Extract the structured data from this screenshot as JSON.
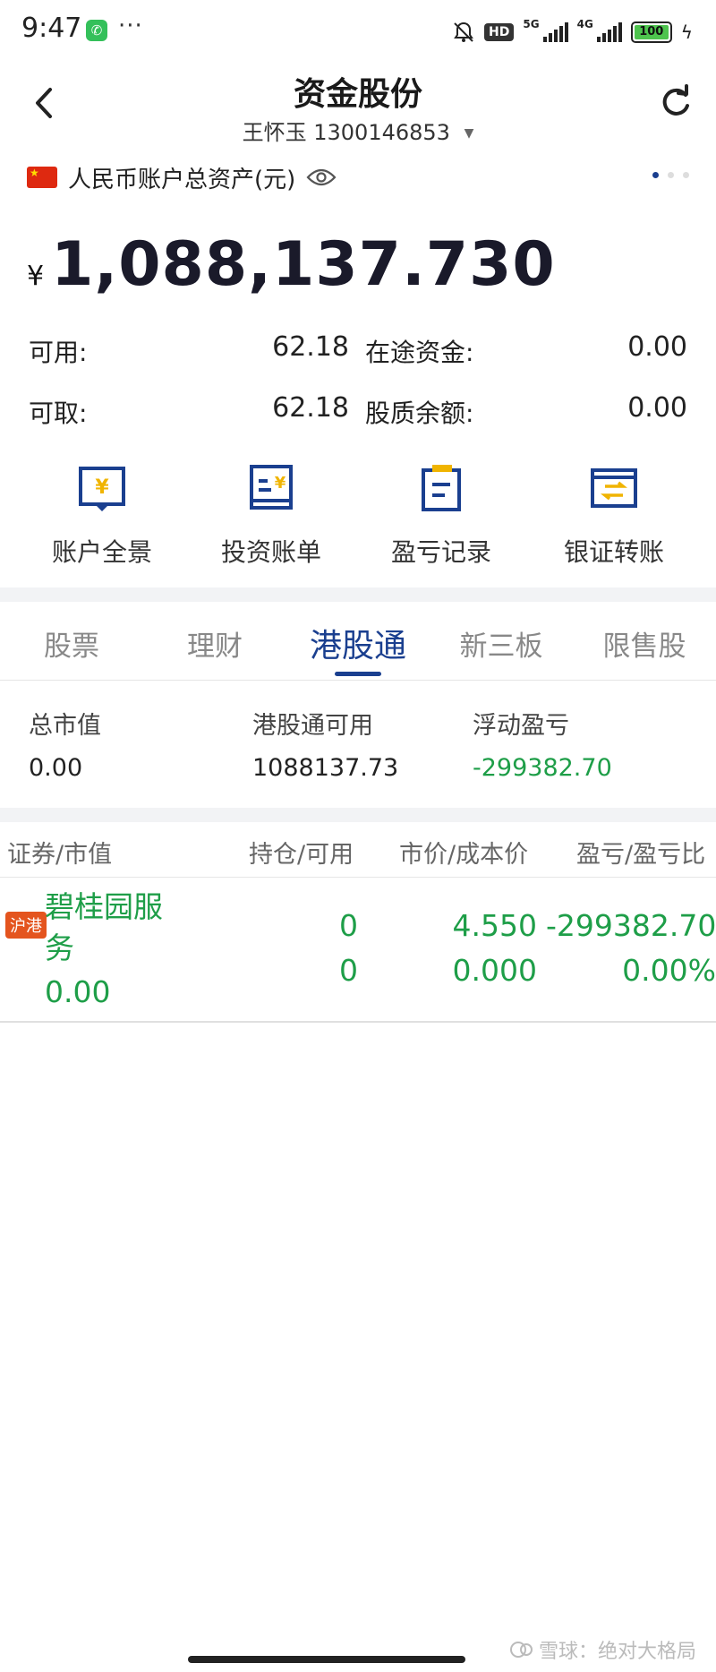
{
  "status_bar": {
    "time": "9:47",
    "more": "···",
    "hd": "HD",
    "net5g": "5G",
    "net4g": "4G",
    "battery": "100"
  },
  "header": {
    "title": "资金股份",
    "account_name": "王怀玉",
    "account_no": "1300146853"
  },
  "asset": {
    "label": "人民币账户总资产(元)",
    "currency_symbol": "¥",
    "total": "1,088,137.730"
  },
  "balances": [
    {
      "label": "可用:",
      "value": "62.18"
    },
    {
      "label": "在途资金:",
      "value": "0.00"
    },
    {
      "label": "可取:",
      "value": "62.18"
    },
    {
      "label": "股质余额:",
      "value": "0.00"
    }
  ],
  "quick_actions": [
    {
      "label": "账户全景",
      "icon": "account-overview-icon"
    },
    {
      "label": "投资账单",
      "icon": "investment-bill-icon"
    },
    {
      "label": "盈亏记录",
      "icon": "profit-loss-record-icon"
    },
    {
      "label": "银证转账",
      "icon": "bank-transfer-icon"
    }
  ],
  "tabs": [
    "股票",
    "理财",
    "港股通",
    "新三板",
    "限售股"
  ],
  "active_tab": "港股通",
  "summary": [
    {
      "label": "总市值",
      "value": "0.00"
    },
    {
      "label": "港股通可用",
      "value": "1088137.73"
    },
    {
      "label": "浮动盈亏",
      "value": "-299382.70"
    }
  ],
  "table": {
    "headers": [
      "证券/市值",
      "持仓/可用",
      "市价/成本价",
      "盈亏/盈亏比"
    ],
    "rows": [
      {
        "badge": "沪港",
        "name": "碧桂园服务",
        "market_value": "0.00",
        "holding": "0",
        "available": "0",
        "price": "4.550",
        "cost": "0.000",
        "pnl": "-299382.70",
        "pnl_ratio": "0.00%"
      }
    ]
  },
  "colors": {
    "accent": "#1a3f8f",
    "gain_green": "#1e9e48",
    "badge_orange": "#e4541e"
  },
  "watermark": "雪球：绝对大格局"
}
